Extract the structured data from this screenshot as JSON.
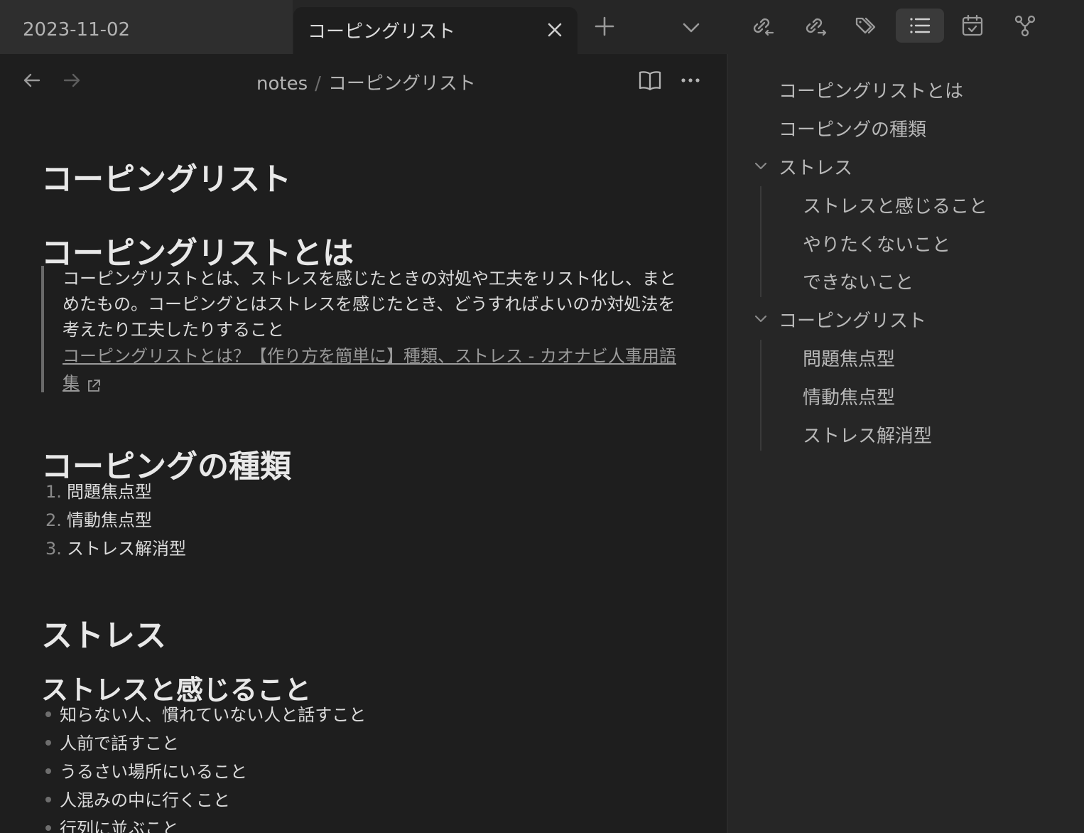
{
  "tabs": [
    {
      "label": "2023-11-02",
      "active": false
    },
    {
      "label": "コーピングリスト",
      "active": true
    }
  ],
  "breadcrumb": {
    "folder": "notes",
    "separator": "/",
    "file": "コーピングリスト"
  },
  "doc": {
    "title": "コーピングリスト",
    "section1": {
      "heading": "コーピングリストとは",
      "quote_line1": "コーピングリストとは、ストレスを感じたときの対処や工夫をリスト化し、まと",
      "quote_line2": "めたもの。コーピングとはストレスを感じたとき、どうすればよいのか対処法を",
      "quote_line3": "考えたり工夫したりすること",
      "link_line1": "コーピングリストとは？【作り方を簡単に】種類、ストレス - カオナビ人事用語",
      "link_line2": "集"
    },
    "section2": {
      "heading": "コーピングの種類",
      "items": [
        {
          "num": "1.",
          "text": "問題焦点型"
        },
        {
          "num": "2.",
          "text": "情動焦点型"
        },
        {
          "num": "3.",
          "text": "ストレス解消型"
        }
      ]
    },
    "section3": {
      "heading": "ストレス",
      "subheading": "ストレスと感じること",
      "items": [
        "知らない人、慣れていない人と話すこと",
        "人前で話すこと",
        "うるさい場所にいること",
        "人混みの中に行くこと",
        "行列に並ぶこと"
      ]
    }
  },
  "outline": {
    "items": [
      "コーピングリストとは",
      "コーピングの種類",
      "ストレス",
      "ストレスと感じること",
      "やりたくないこと",
      "できないこと",
      "コーピングリスト",
      "問題焦点型",
      "情動焦点型",
      "ストレス解消型"
    ]
  },
  "colors": {
    "background": "#1e1e1e",
    "sidebar": "#262626",
    "text": "#dadada",
    "muted": "#b3b3b3"
  }
}
